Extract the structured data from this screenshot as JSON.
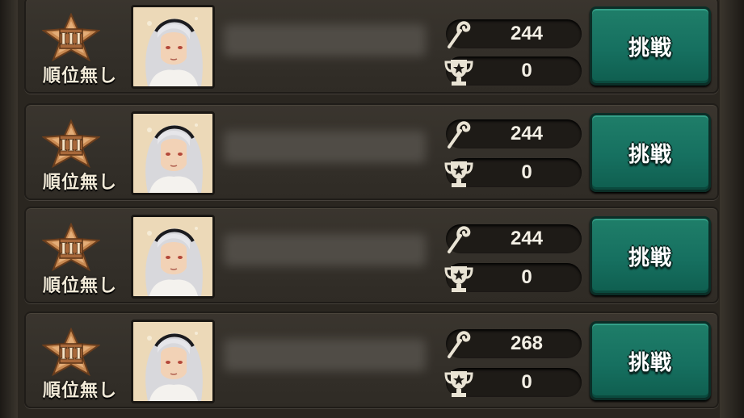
{
  "colors": {
    "button_green": "#167060",
    "row_bg": "#34302a",
    "pill_bg": "#1e1b17",
    "emblem_bronze": "#c98a52"
  },
  "icons": {
    "rank": "bronze-star-rank-III-icon",
    "power": "staff-icon",
    "trophy": "trophy-icon"
  },
  "rows": [
    {
      "rank_numeral": "III",
      "rank_label": "順位無し",
      "power": "244",
      "trophies": "0",
      "button": "挑戦"
    },
    {
      "rank_numeral": "III",
      "rank_label": "順位無し",
      "power": "244",
      "trophies": "0",
      "button": "挑戦"
    },
    {
      "rank_numeral": "III",
      "rank_label": "順位無し",
      "power": "244",
      "trophies": "0",
      "button": "挑戦"
    },
    {
      "rank_numeral": "III",
      "rank_label": "順位無し",
      "power": "268",
      "trophies": "0",
      "button": "挑戦"
    }
  ]
}
